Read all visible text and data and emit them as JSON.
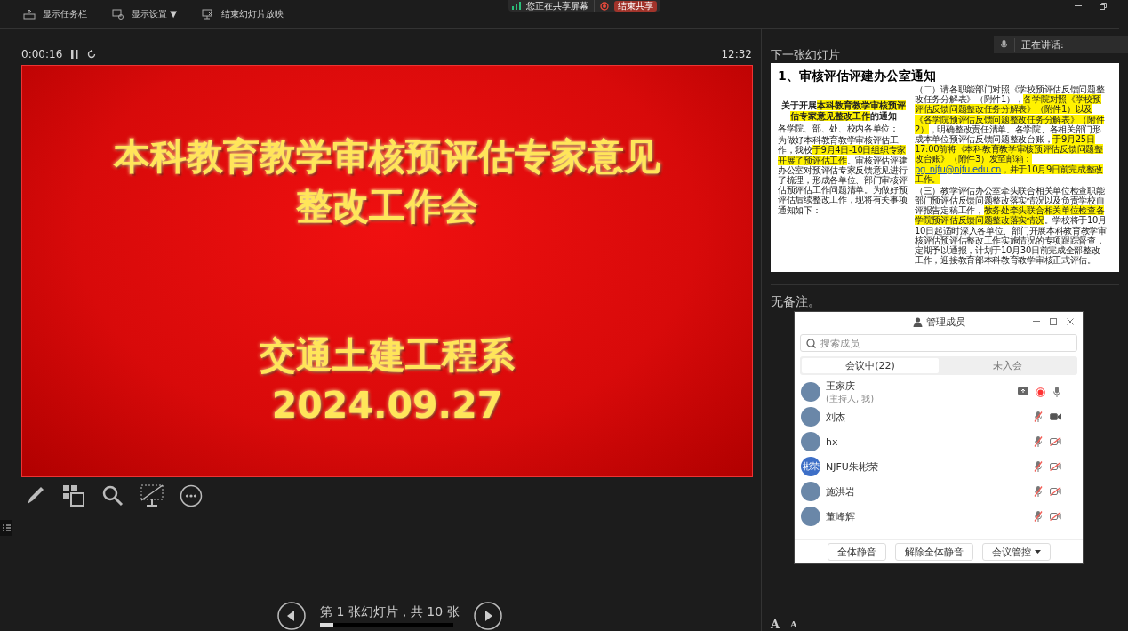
{
  "toolbar": {
    "items": [
      {
        "kind": "taskbar",
        "label": "显示任务栏"
      },
      {
        "kind": "display",
        "label": "显示设置 ▼"
      },
      {
        "kind": "end",
        "label": "结束幻灯片放映"
      }
    ]
  },
  "share_bar": {
    "status": "您正在共享屏幕",
    "stop_button": "结束共享"
  },
  "speaking": {
    "label": "正在讲话:"
  },
  "timer": {
    "elapsed": "0:00:16",
    "clock": "12:32"
  },
  "current_slide": {
    "title_lines": [
      "本科教育教学审核预评估专家意见",
      "整改工作会"
    ],
    "subtitle_lines": [
      "交通土建工程系",
      "2024.09.27"
    ]
  },
  "slide_tools": [
    {
      "kind": "pen"
    },
    {
      "kind": "grid"
    },
    {
      "kind": "zoom"
    },
    {
      "kind": "blackout"
    },
    {
      "kind": "more"
    }
  ],
  "navigation": {
    "label": "第 1 张幻灯片，共 10 张",
    "level": 0.1
  },
  "next_slide": {
    "heading": "下一张幻灯片",
    "title": "1、审核评估评建办公室通知",
    "doc_title": [
      {
        "text": "关于开展",
        "highlight": false
      },
      {
        "text": "本科教育教学审核预评估专家意见整改工作",
        "highlight": true
      },
      {
        "text": "的通知",
        "highlight": false
      }
    ],
    "left_paragraphs": [
      [
        {
          "text": "各学院、部、处、校内各单位：",
          "highlight": false
        }
      ],
      [
        {
          "text": "为做好本科教育教学审核评估工作，我校",
          "highlight": false
        },
        {
          "text": "于9月4日-10日组织专家开展了预评估工作",
          "highlight": true
        },
        {
          "text": "。审核评估评建办公室对预评估专家反馈意见进行了梳理，形成各单位、部门审核评估预评估工作问题清单。为做好预评估后续整改工作，现将有关事项通知如下：",
          "highlight": false
        }
      ]
    ],
    "right_paragraphs": [
      [
        {
          "text": "（二）请各职能部门对照《学校预评估反馈问题整改任务分解表》（附件1），",
          "highlight": false
        },
        {
          "text": "各学院对照《学校预评估反馈问题整改任务分解表》（附件1）以及《各学院预评估反馈问题整改任务分解表》（附件2）",
          "highlight": true
        },
        {
          "text": "，明确整改责任清单。各学院、各相关部门形成本单位预评估反馈问题整改台账，",
          "highlight": false
        },
        {
          "text": "于9月25日17:00前将《本科教育教学审核预评估反馈问题整改台账》（附件3）发至邮箱：",
          "highlight": true
        },
        {
          "text": "pg_njfu@njfu.edu.cn",
          "highlight": true,
          "kind": "link"
        },
        {
          "text": "，并于10月9日前完成整改工作。",
          "highlight": true
        }
      ],
      [
        {
          "text": "（三）教学评估办公室牵头联合相关单位检查职能部门预评估反馈问题整改落实情况以及负责学校自评报告定稿工作，",
          "highlight": false
        },
        {
          "text": "教务处牵头联合相关单位检查各学院预评估反馈问题整改落实情况",
          "highlight": true
        },
        {
          "text": "。学校将于10月10日起适时深入各单位、部门开展本科教育教学审核评估预评估整改工作实施情况的专项跟踪督查，定期予以通报，计划于10月30日前完成全部整改工作，迎接教育部本科教育教学审核正式评估。",
          "highlight": false
        }
      ]
    ]
  },
  "notes": {
    "text": "无备注。",
    "font_buttons": [
      "A",
      "A"
    ]
  },
  "members_window": {
    "title": "管理成员",
    "search": {
      "placeholder": "搜索成员"
    },
    "tabs": [
      {
        "label": "会议中(22)",
        "selected": true
      },
      {
        "label": "未入会",
        "selected": false
      }
    ],
    "members": [
      {
        "name": "王家庆",
        "role": "(主持人, 我)",
        "host": true,
        "mic_muted": false
      },
      {
        "name": "刘杰",
        "host": false,
        "mic_muted": true,
        "camera_on": true
      },
      {
        "name": "hx",
        "host": false,
        "mic_muted": true,
        "camera_on": false
      },
      {
        "name": "NJFU朱彬荣",
        "avatar_text": "彬荣",
        "host": false,
        "mic_muted": true,
        "camera_on": false
      },
      {
        "name": "施洪岩",
        "host": false,
        "mic_muted": true,
        "camera_on": false
      },
      {
        "name": "董峰辉",
        "host": false,
        "mic_muted": true,
        "camera_on": false
      }
    ],
    "buttons": [
      {
        "label": "全体静音",
        "dropdown": false
      },
      {
        "label": "解除全体静音",
        "dropdown": false
      },
      {
        "label": "会议管控",
        "dropdown": true
      }
    ]
  }
}
